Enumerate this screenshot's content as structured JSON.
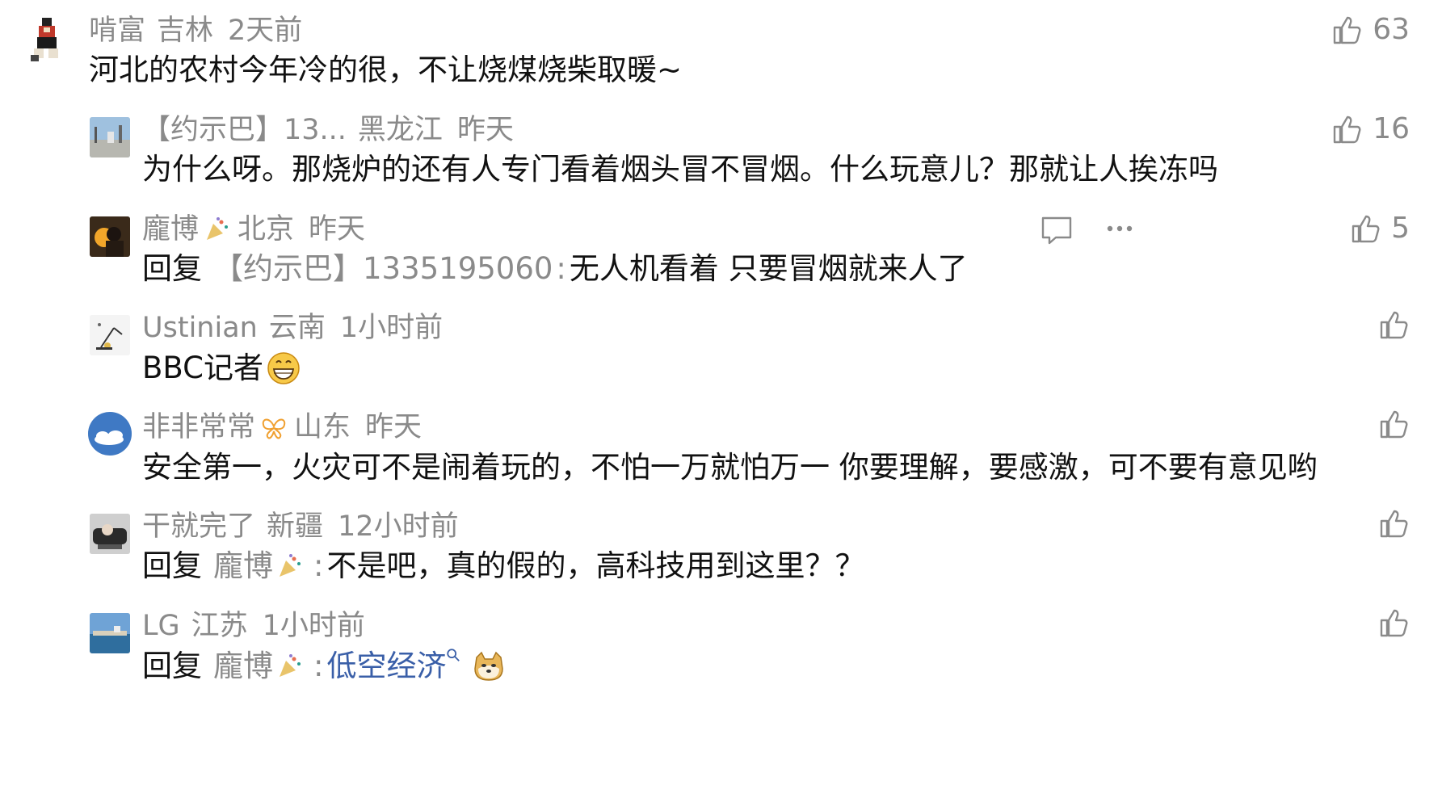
{
  "comments": [
    {
      "user": "啃富",
      "location": "吉林",
      "time": "2天前",
      "text": "河北的农村今年冷的很，不让烧煤烧柴取暖~",
      "likes": "63",
      "avatar_icon": "pixel-character-avatar"
    },
    {
      "user": "【约示巴】13...",
      "location": "黑龙江",
      "time": "昨天",
      "text": "为什么呀。那烧炉的还有人专门看着烟头冒不冒烟。什么玩意儿？那就让人挨冻吗",
      "likes": "16",
      "avatar_icon": "street-photo-avatar"
    },
    {
      "user": "龐博",
      "badge_icon": "party-popper-icon",
      "location": "北京",
      "time": "昨天",
      "reply_label": "回复",
      "reply_target": "【约示巴】1335195060",
      "text": "无人机看着 只要冒烟就来人了",
      "likes": "5",
      "avatar_icon": "dark-portrait-avatar"
    },
    {
      "user": "Ustinian",
      "location": "云南",
      "time": "1小时前",
      "text": "BBC记者",
      "emoji": "grinning-face-icon",
      "avatar_icon": "lamp-sketch-avatar"
    },
    {
      "user": "非非常常",
      "badge_icon": "butterfly-badge-icon",
      "location": "山东",
      "time": "昨天",
      "text": "安全第一，火灾可不是闹着玩的，不怕一万就怕万一 你要理解，要感激，可不要有意见哟",
      "avatar_icon": "sky-cloud-avatar"
    },
    {
      "user": "干就完了",
      "location": "新疆",
      "time": "12小时前",
      "reply_label": "回复",
      "reply_target": "龐博",
      "text": "不是吧，真的假的，高科技用到这里？？",
      "avatar_icon": "car-photo-avatar"
    },
    {
      "user": "LG",
      "location": "江苏",
      "time": "1小时前",
      "reply_label": "回复",
      "reply_target": "龐博",
      "link_text": "低空经济",
      "emoji": "doge-face-icon",
      "avatar_icon": "seaside-avatar"
    }
  ],
  "colors": {
    "meta_gray": "#8a8a8a",
    "text_dark": "#111111",
    "link_blue": "#3a5fa8"
  }
}
